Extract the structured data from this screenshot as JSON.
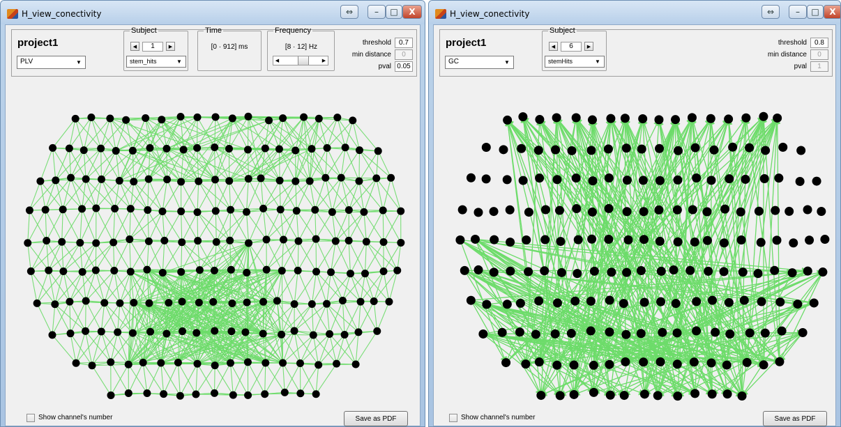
{
  "colors": {
    "edge": "#6ddc6a",
    "node": "#000000",
    "client_bg": "#f0f0f0"
  },
  "left_window": {
    "title": "H_view_conectivity",
    "project": "project1",
    "measure": "PLV",
    "subject": {
      "legend": "Subject",
      "value": "1",
      "dataset": "stem_hits"
    },
    "time": {
      "legend": "Time",
      "value": "[0 · 912] ms"
    },
    "frequency": {
      "legend": "Frequency",
      "value": "[8 · 12] Hz",
      "slider_fraction": 0.58
    },
    "params": [
      {
        "label": "threshold",
        "value": "0.7",
        "enabled": true
      },
      {
        "label": "min distance",
        "value": "0",
        "enabled": false
      },
      {
        "label": "pval",
        "value": "0.05",
        "enabled": true
      }
    ],
    "show_channel_label": "Show channel's number",
    "show_channel_checked": false,
    "save_label": "Save as PDF",
    "titlebar_buttons": {
      "restore": "⇔",
      "minimize": "–",
      "maximize": "□",
      "close": "X"
    }
  },
  "right_window": {
    "title": "H_view_conectivity",
    "project": "project1",
    "measure": "GC",
    "subject": {
      "legend": "Subject",
      "value": "6",
      "dataset": "stemHits"
    },
    "params": [
      {
        "label": "threshold",
        "value": "0.8",
        "enabled": true
      },
      {
        "label": "min distance",
        "value": "0",
        "enabled": false
      },
      {
        "label": "pval",
        "value": "1",
        "enabled": false
      }
    ],
    "show_channel_label": "Show channel's number",
    "show_channel_checked": false,
    "save_label": "Save as PDF",
    "titlebar_buttons": {
      "restore": "⇔",
      "minimize": "–",
      "maximize": "□",
      "close": "X"
    }
  },
  "icons": {
    "app": "matlab-icon",
    "left_arrow": "◀",
    "right_arrow": "▶",
    "dropdown": "▼"
  }
}
